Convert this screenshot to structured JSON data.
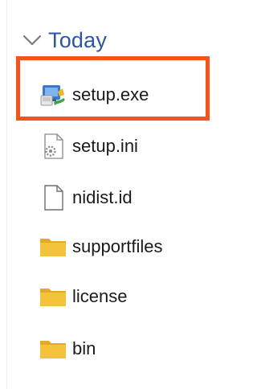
{
  "group": {
    "title": "Today",
    "expanded": true
  },
  "files": [
    {
      "name": "setup.exe",
      "icon": "installer-icon",
      "highlighted": true
    },
    {
      "name": "setup.ini",
      "icon": "settings-file-icon"
    },
    {
      "name": "nidist.id",
      "icon": "blank-file-icon"
    },
    {
      "name": "supportfiles",
      "icon": "folder-icon"
    },
    {
      "name": "license",
      "icon": "folder-icon"
    },
    {
      "name": "bin",
      "icon": "folder-icon"
    }
  ],
  "colors": {
    "group_title": "#2b56a8",
    "highlight": "#f2541e",
    "folder": "#f5c33b",
    "text": "#1a1a1a"
  }
}
